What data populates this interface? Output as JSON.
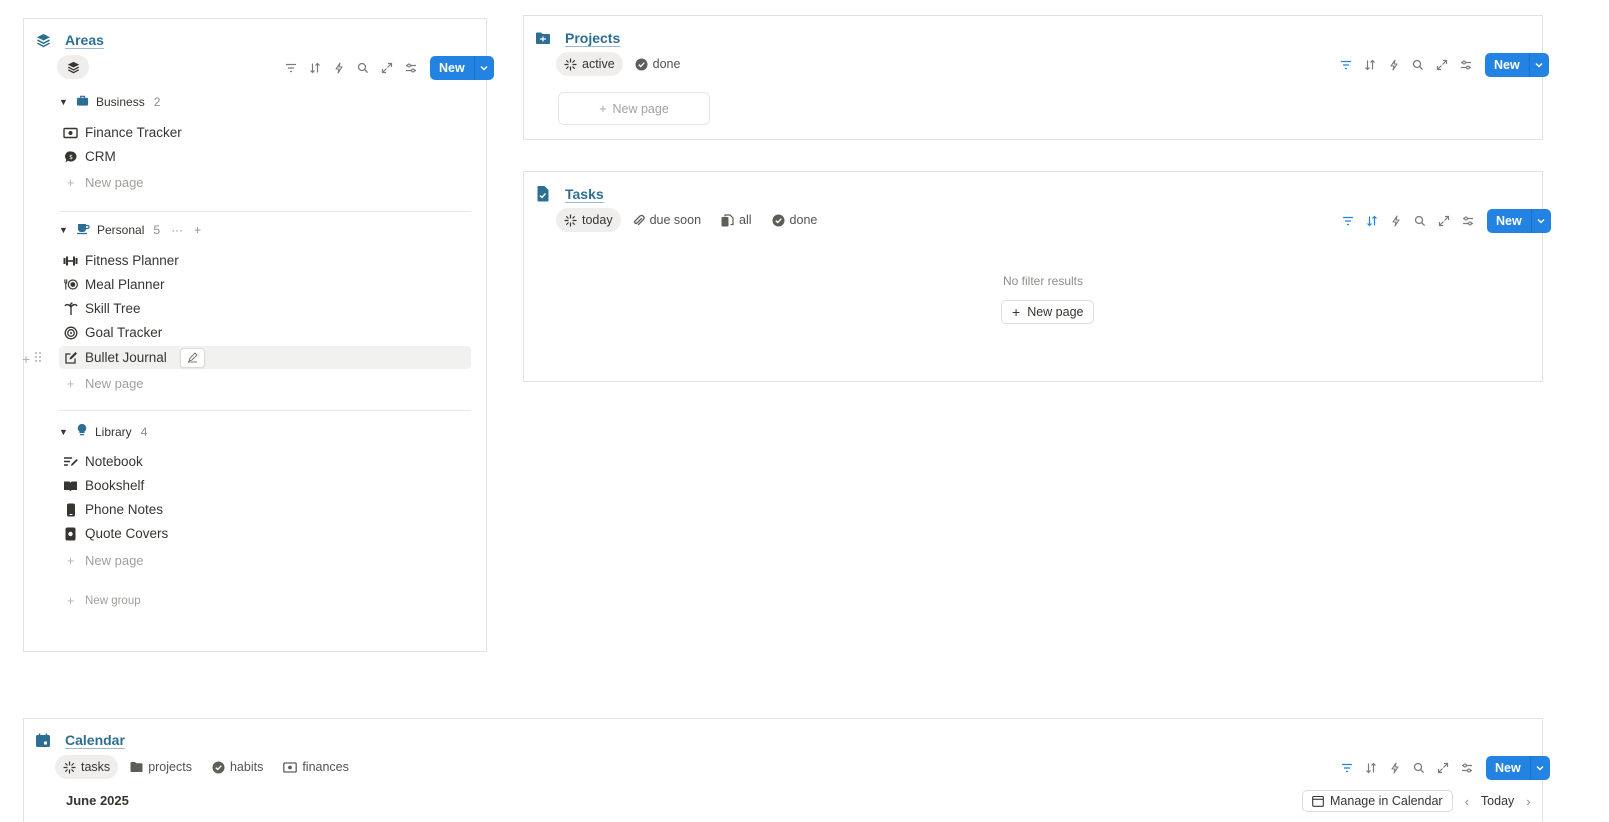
{
  "areas": {
    "title": "Areas",
    "new_label": "New",
    "groups": [
      {
        "name": "Business",
        "count": "2",
        "items": [
          {
            "label": "Finance Tracker",
            "icon": "money-icon"
          },
          {
            "label": "CRM",
            "icon": "chat-icon"
          }
        ],
        "new_label": "New page"
      },
      {
        "name": "Personal",
        "count": "5",
        "items": [
          {
            "label": "Fitness Planner",
            "icon": "dumbbell-icon"
          },
          {
            "label": "Meal Planner",
            "icon": "fork-plate-icon"
          },
          {
            "label": "Skill Tree",
            "icon": "palm-tree-icon"
          },
          {
            "label": "Goal Tracker",
            "icon": "target-icon"
          },
          {
            "label": "Bullet Journal",
            "icon": "edit-icon"
          }
        ],
        "new_label": "New page"
      },
      {
        "name": "Library",
        "count": "4",
        "items": [
          {
            "label": "Notebook",
            "icon": "notes-icon"
          },
          {
            "label": "Bookshelf",
            "icon": "book-icon"
          },
          {
            "label": "Phone Notes",
            "icon": "phone-icon"
          },
          {
            "label": "Quote Covers",
            "icon": "quote-icon"
          }
        ],
        "new_label": "New page"
      }
    ],
    "new_group_label": "New group"
  },
  "projects": {
    "title": "Projects",
    "views": [
      "active",
      "done"
    ],
    "new_label": "New",
    "new_page_label": "New page"
  },
  "tasks": {
    "title": "Tasks",
    "views": [
      "today",
      "due soon",
      "all",
      "done"
    ],
    "new_label": "New",
    "empty_text": "No filter results",
    "new_page_label": "New page"
  },
  "calendar": {
    "title": "Calendar",
    "views": [
      "tasks",
      "projects",
      "habits",
      "finances"
    ],
    "new_label": "New",
    "month": "June 2025",
    "manage_label": "Manage in Calendar",
    "today_label": "Today"
  },
  "colors": {
    "accent": "#2383e2",
    "title_link": "#2d6f94",
    "icon_blue": "#2d6f94"
  }
}
